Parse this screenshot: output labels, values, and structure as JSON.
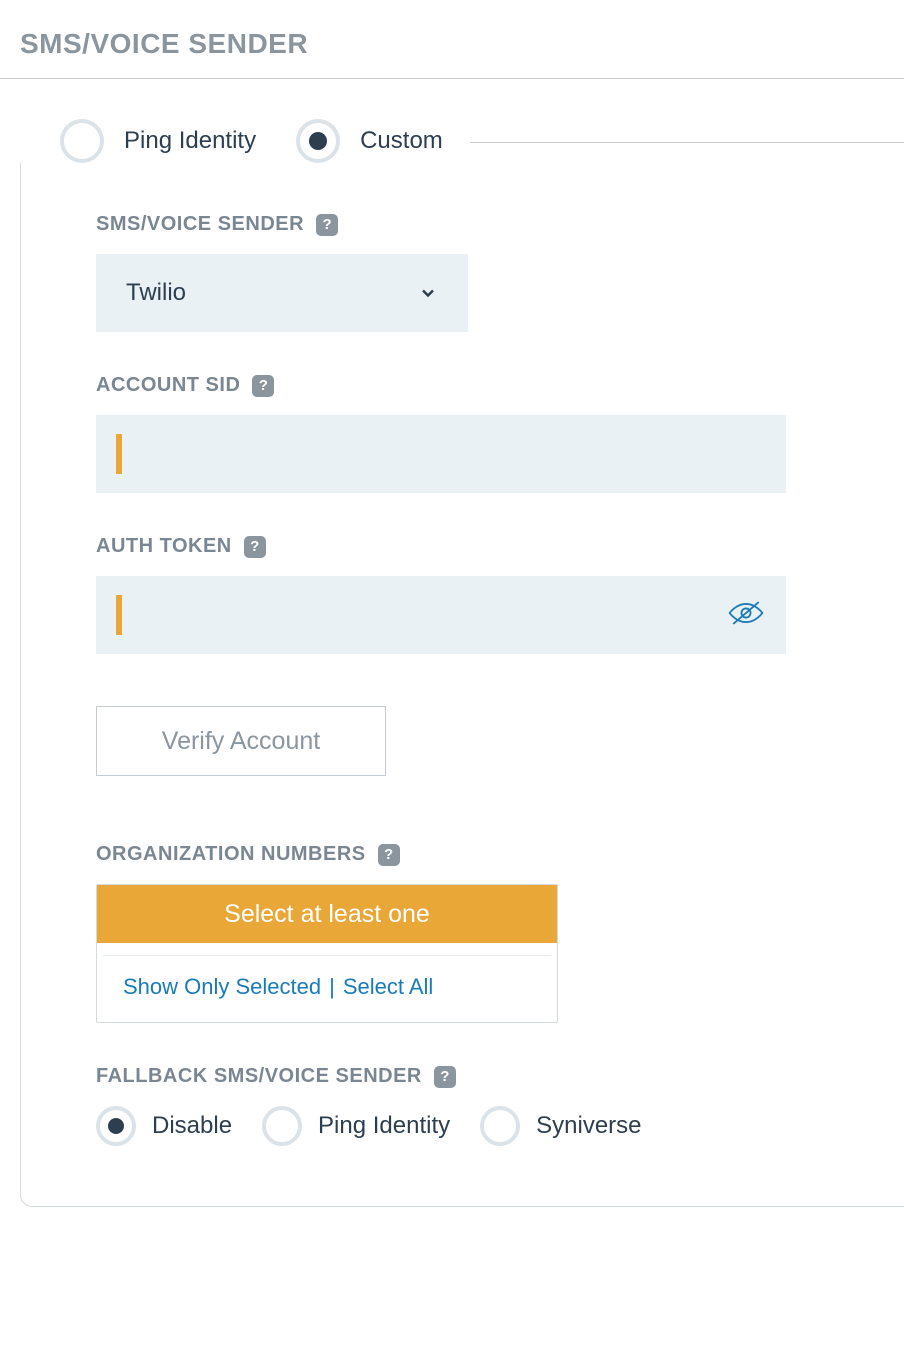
{
  "header": {
    "title": "SMS/VOICE SENDER"
  },
  "tabs": {
    "items": [
      {
        "label": "Ping Identity",
        "selected": false
      },
      {
        "label": "Custom",
        "selected": true
      }
    ]
  },
  "senderField": {
    "label": "SMS/VOICE SENDER",
    "value": "Twilio"
  },
  "accountSid": {
    "label": "ACCOUNT SID",
    "value": ""
  },
  "authToken": {
    "label": "AUTH TOKEN",
    "value": ""
  },
  "verifyButton": {
    "label": "Verify Account"
  },
  "orgNumbers": {
    "label": "ORGANIZATION NUMBERS",
    "banner": "Select at least one",
    "showSelected": "Show Only Selected",
    "selectAll": "Select All"
  },
  "fallback": {
    "label": "FALLBACK SMS/VOICE SENDER",
    "options": [
      {
        "label": "Disable",
        "selected": true
      },
      {
        "label": "Ping Identity",
        "selected": false
      },
      {
        "label": "Syniverse",
        "selected": false
      }
    ]
  }
}
